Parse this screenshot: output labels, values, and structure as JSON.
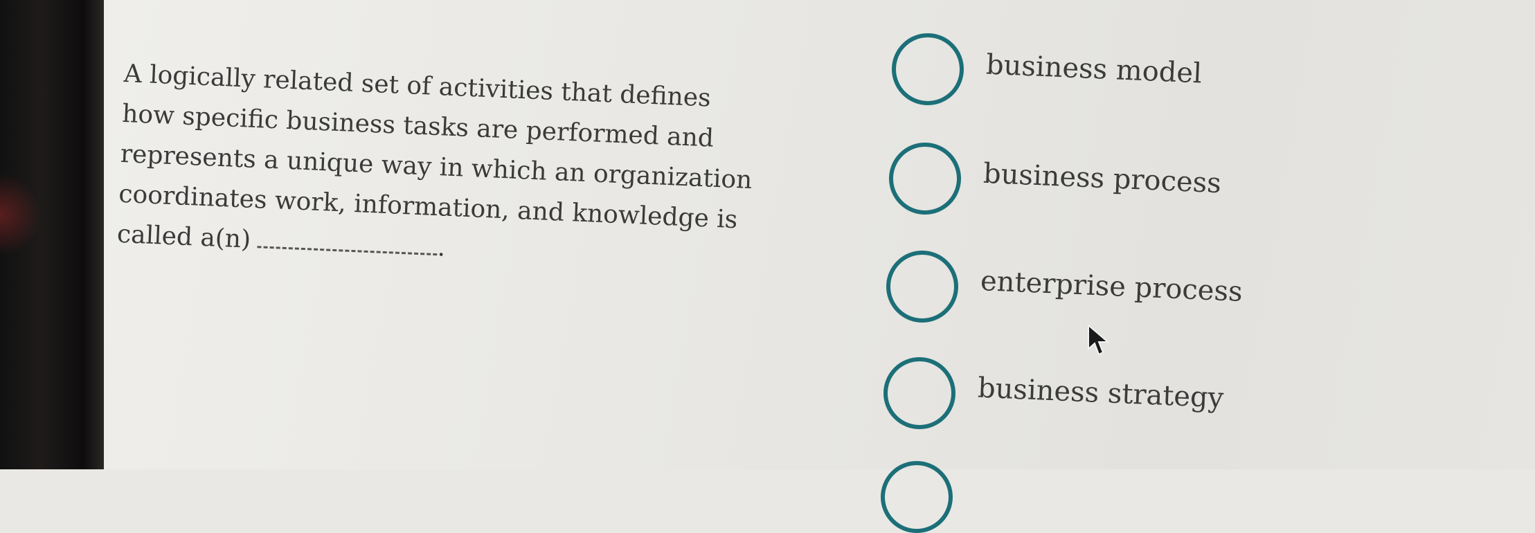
{
  "question": {
    "text": "A logically related set of activities that defines how specific business tasks are performed and represents a unique way in which an organization coordinates work, information, and knowledge is called a(n)",
    "end": "."
  },
  "options": [
    {
      "label": "business model"
    },
    {
      "label": "business process"
    },
    {
      "label": "enterprise process"
    },
    {
      "label": "business strategy"
    }
  ],
  "colors": {
    "radio_border": "#1c6f78",
    "text": "#3a3a3a",
    "background": "#e9e8e4"
  },
  "icons": {
    "radio": "radio-unselected-icon",
    "cursor": "mouse-pointer-icon"
  }
}
